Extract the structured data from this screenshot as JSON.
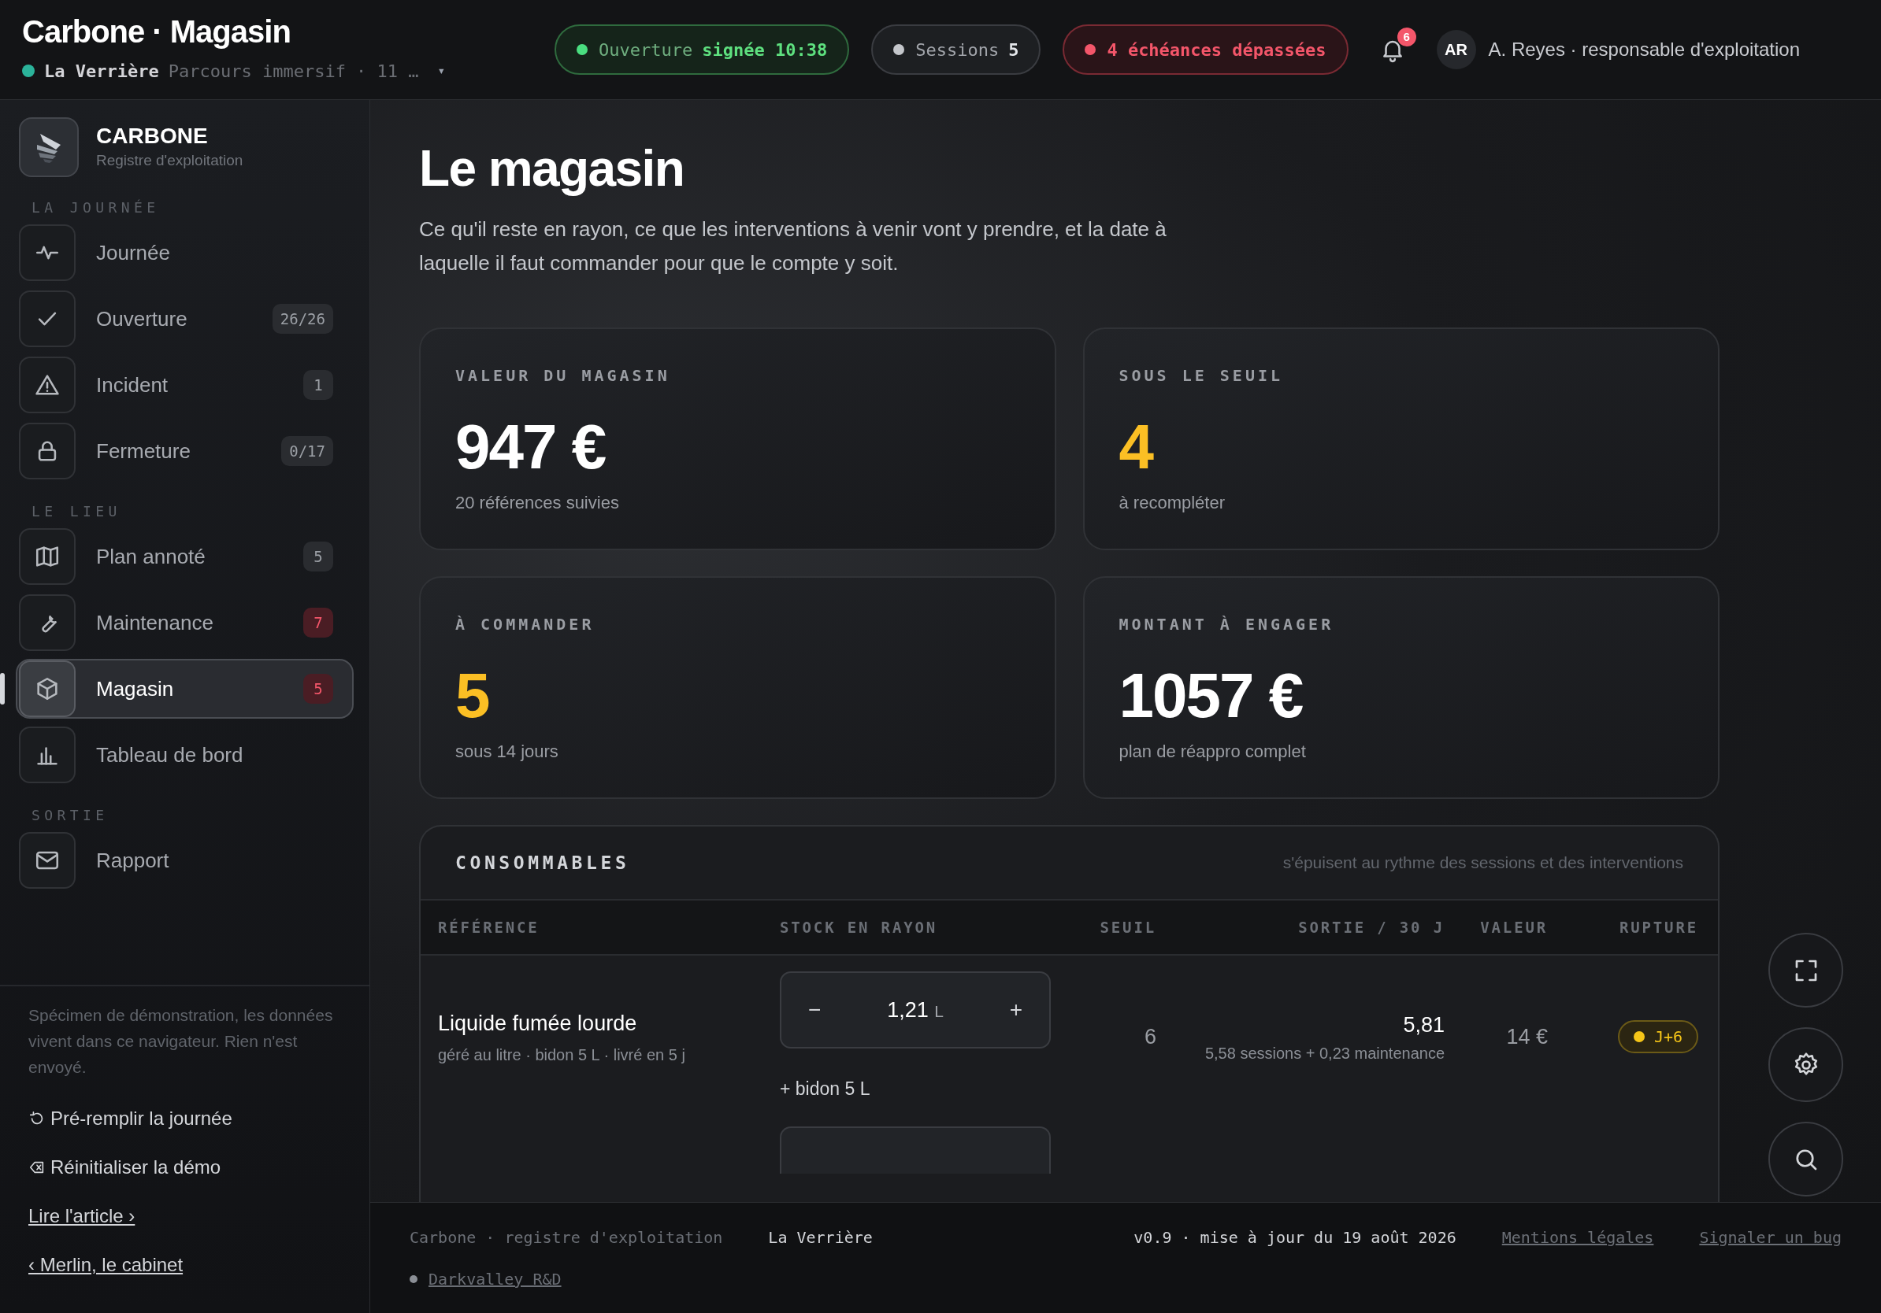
{
  "header": {
    "title": "Carbone · Magasin",
    "venue": {
      "name": "La Verrière",
      "detail": "Parcours immersif · 11 …",
      "caret": "▾",
      "color": "#2bb39a"
    },
    "pills": [
      {
        "kind": "success",
        "label": "Ouverture",
        "value": "signée 10:38"
      },
      {
        "kind": "neutral",
        "label": "Sessions",
        "value": "5"
      },
      {
        "kind": "danger",
        "value": "4 échéances dépassées"
      }
    ],
    "notifications": {
      "count": "6"
    },
    "user": {
      "initials": "AR",
      "name": "A. Reyes · responsable d'exploitation"
    }
  },
  "sidebar": {
    "brand": {
      "name": "CARBONE",
      "subtitle": "Registre d'exploitation"
    },
    "sections": [
      {
        "title": "LA JOURNÉE",
        "items": [
          {
            "label": "Journée",
            "selected": false
          },
          {
            "label": "Ouverture",
            "badge": "26/26",
            "alert": false,
            "selected": false
          },
          {
            "label": "Incident",
            "badge": "1",
            "alert": false,
            "selected": false
          },
          {
            "label": "Fermeture",
            "badge": "0/17",
            "alert": false,
            "selected": false
          }
        ]
      },
      {
        "title": "LE LIEU",
        "items": [
          {
            "label": "Plan annoté",
            "badge": "5",
            "alert": false,
            "selected": false
          },
          {
            "label": "Maintenance",
            "badge": "7",
            "alert": true,
            "selected": false
          },
          {
            "label": "Magasin",
            "badge": "5",
            "alert": true,
            "selected": true
          },
          {
            "label": "Tableau de bord",
            "selected": false
          }
        ]
      },
      {
        "title": "SORTIE",
        "items": [
          {
            "label": "Rapport",
            "selected": false
          }
        ]
      }
    ],
    "note": "Spécimen de démonstration, les données vivent dans ce navigateur. Rien n'est envoyé.",
    "actions": [
      {
        "kind": "action",
        "label": "Pré-remplir la journée"
      },
      {
        "kind": "action",
        "label": "Réinitialiser la démo"
      },
      {
        "kind": "link",
        "label": "Lire l'article ›"
      },
      {
        "kind": "link",
        "label": "‹ Merlin, le cabinet"
      }
    ]
  },
  "main": {
    "title": "Le magasin",
    "intro": "Ce qu'il reste en rayon, ce que les interventions à venir vont y prendre, et la date à laquelle il faut commander pour que le compte y soit.",
    "cards": [
      {
        "label": "VALEUR DU MAGASIN",
        "value": "947 €",
        "caption": "20 références suivies",
        "highlight": false
      },
      {
        "label": "SOUS LE SEUIL",
        "value": "4",
        "caption": "à recompléter",
        "highlight": true
      },
      {
        "label": "À COMMANDER",
        "value": "5",
        "caption": "sous 14 jours",
        "highlight": true
      },
      {
        "label": "MONTANT À ENGAGER",
        "value": "1057 €",
        "caption": "plan de réappro complet",
        "highlight": false
      }
    ],
    "table": {
      "title": "CONSOMMABLES",
      "note": "s'épuisent au rythme des sessions et des interventions",
      "columns": [
        "RÉFÉRENCE",
        "STOCK EN RAYON",
        "SEUIL",
        "SORTIE / 30 J",
        "VALEUR",
        "RUPTURE"
      ],
      "rows": [
        {
          "name": "Liquide fumée lourde",
          "details": "géré au litre · bidon 5 L · livré en 5 j",
          "stock": {
            "minus": "−",
            "value": "1,21",
            "unit": "L",
            "plus": "+"
          },
          "restock": "+ bidon 5 L",
          "threshold": "6",
          "outflow": "5,81",
          "outflow_detail": "5,58 sessions + 0,23 maintenance",
          "value": "14 €",
          "rupture": {
            "label": "J+6",
            "color": "#f5c518"
          }
        }
      ]
    }
  },
  "footer": {
    "left": [
      {
        "kind": "muted",
        "text": "Carbone · registre d'exploitation"
      },
      {
        "kind": "strong",
        "text": "La Verrière"
      }
    ],
    "right": [
      {
        "kind": "strong",
        "text": "v0.9 · mise à jour du 19 août 2026"
      },
      {
        "kind": "link",
        "text": "Mentions légales"
      },
      {
        "kind": "link",
        "text": "Signaler un bug"
      }
    ],
    "credit": "Darkvalley R&D"
  }
}
